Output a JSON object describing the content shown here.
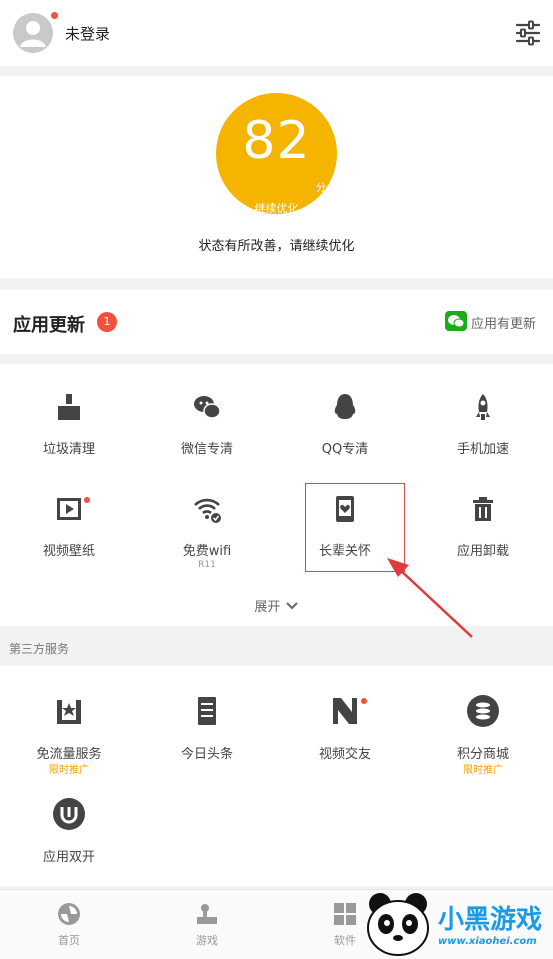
{
  "header": {
    "login_text": "未登录"
  },
  "score": {
    "value": "82",
    "unit": "分",
    "subtitle": "继续优化",
    "status": "状态有所改善，请继续优化"
  },
  "update": {
    "title": "应用更新",
    "badge": "1",
    "right_text": "应用有更新"
  },
  "tools": [
    {
      "label": "垃圾清理",
      "icon": "broom-icon"
    },
    {
      "label": "微信专清",
      "icon": "wechat-icon"
    },
    {
      "label": "QQ专清",
      "icon": "qq-penguin-icon"
    },
    {
      "label": "手机加速",
      "icon": "rocket-icon"
    },
    {
      "label": "视频壁纸",
      "icon": "video-wallpaper-icon"
    },
    {
      "label": "免费wifi",
      "icon": "wifi-icon",
      "sub": "R11"
    },
    {
      "label": "长辈关怀",
      "icon": "elder-care-icon"
    },
    {
      "label": "应用卸载",
      "icon": "trash-icon"
    }
  ],
  "expand_label": "展开",
  "third_party": {
    "title": "第三方服务",
    "items": [
      {
        "label": "免流量服务",
        "tag": "限时推广",
        "icon": "free-data-icon"
      },
      {
        "label": "今日头条",
        "icon": "news-icon"
      },
      {
        "label": "视频交友",
        "icon": "video-dating-icon"
      },
      {
        "label": "积分商城",
        "tag": "限时推广",
        "icon": "points-mall-icon"
      },
      {
        "label": "应用双开",
        "icon": "dual-app-icon"
      }
    ]
  },
  "nav": [
    {
      "label": "首页",
      "icon": "home-icon"
    },
    {
      "label": "游戏",
      "icon": "game-icon"
    },
    {
      "label": "软件",
      "icon": "apps-icon"
    }
  ],
  "watermark": {
    "brand": "小黑游戏",
    "url": "www.xiaohei.com"
  },
  "colors": {
    "accent": "#f4b400",
    "badge": "#f0503c",
    "wechat": "#1aad19",
    "annotation": "#e03a3a"
  }
}
